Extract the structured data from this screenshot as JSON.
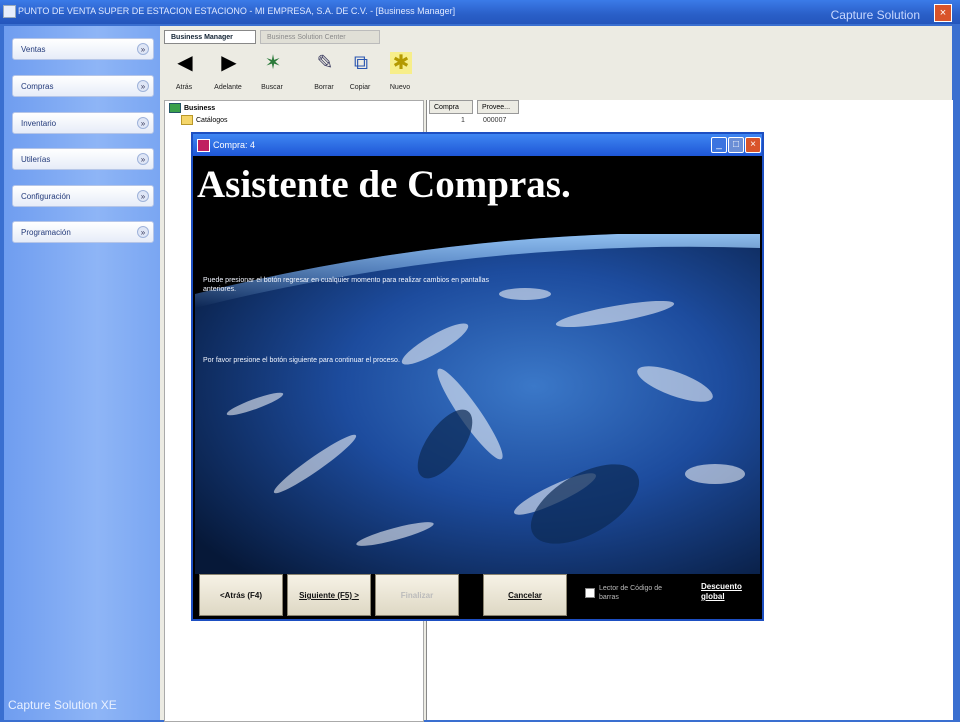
{
  "window": {
    "title": "PUNTO DE VENTA SUPER DE ESTACION ESTACIONO - MI EMPRESA, S.A. DE C.V. - [Business Manager]",
    "brand": "Capture Solution",
    "close": "×"
  },
  "sidebar": {
    "items": [
      {
        "label": "Ventas",
        "chevron": "»"
      },
      {
        "label": "Compras",
        "chevron": "»"
      },
      {
        "label": "Inventario",
        "chevron": "»"
      },
      {
        "label": "Utilerías",
        "chevron": "»"
      },
      {
        "label": "Configuración",
        "chevron": "»"
      },
      {
        "label": "Programación",
        "chevron": "»"
      }
    ],
    "footer": "Capture Solution XE"
  },
  "tabs": {
    "active": "Business Manager",
    "inactive": "Business Solution Center"
  },
  "toolbar": {
    "buttons": [
      {
        "label": "Atrás",
        "icon": "back-arrow-icon",
        "glyph": "◀"
      },
      {
        "label": "Adelante",
        "icon": "forward-arrow-icon",
        "glyph": "▶"
      },
      {
        "label": "Buscar",
        "icon": "search-icon",
        "glyph": "✶"
      },
      {
        "label": "Borrar",
        "icon": "delete-icon",
        "glyph": "✎"
      },
      {
        "label": "Copiar",
        "icon": "copy-icon",
        "glyph": "⧉"
      },
      {
        "label": "Nuevo",
        "icon": "new-icon",
        "glyph": "✱"
      }
    ]
  },
  "tree": {
    "root": "Business",
    "child": "Catálogos"
  },
  "grid": {
    "columns": [
      "Compra",
      "Provee..."
    ],
    "row": {
      "compra": "1",
      "provee": "000007"
    }
  },
  "dialog": {
    "title": "Compra: 4",
    "heading": "Asistente de Compras.",
    "intro1": "Puede presionar el botón regresar en cualquier momento para realizar cambios en pantallas anteriores.",
    "intro2": "Por favor presione el botón siguiente para continuar el proceso.",
    "buttons": {
      "back": "<Atrás (F4)",
      "next": "Siguiente (F5) >",
      "finish": "Finalizar",
      "cancel": "Cancelar"
    },
    "lector": "Lector de Código de barras",
    "descuento": "Descuento global"
  },
  "colors": {
    "accent": "#2a5fc8",
    "sidebar": "#7aa6f2",
    "dialog_title": "#1e56d6"
  }
}
